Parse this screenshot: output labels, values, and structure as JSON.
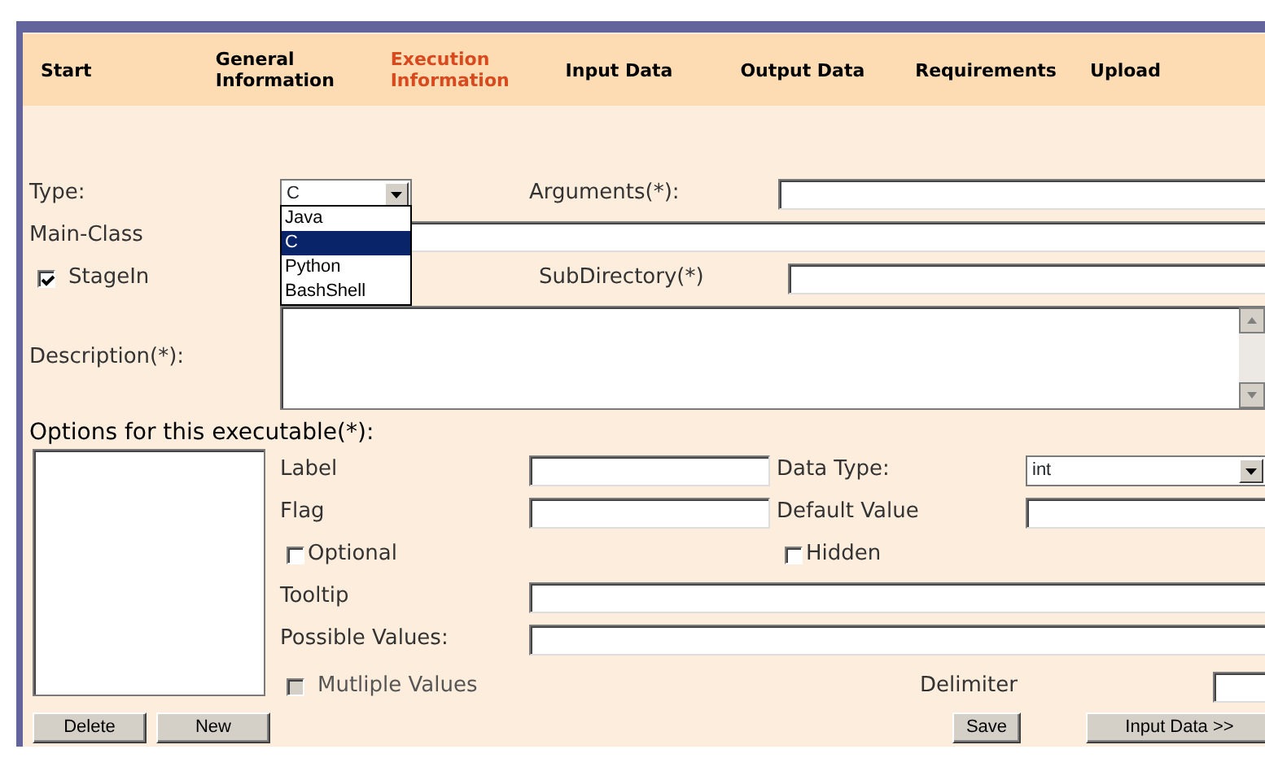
{
  "tabs": [
    {
      "label": "Start",
      "selected": false
    },
    {
      "label": "General Information",
      "selected": false
    },
    {
      "label": "Execution Information",
      "selected": true
    },
    {
      "label": "Input Data",
      "selected": false
    },
    {
      "label": "Output Data",
      "selected": false
    },
    {
      "label": "Requirements",
      "selected": false
    },
    {
      "label": "Upload",
      "selected": false
    }
  ],
  "type_field": {
    "label": "Type:",
    "value": "C",
    "expanded": true,
    "options": [
      {
        "label": "Java",
        "selected": false
      },
      {
        "label": "C",
        "selected": true
      },
      {
        "label": "Python",
        "selected": false
      },
      {
        "label": "BashShell",
        "selected": false
      }
    ]
  },
  "arguments": {
    "label": "Arguments(*):"
  },
  "main_class": {
    "label": "Main-Class"
  },
  "stage_in": {
    "label": "StageIn",
    "checked": true
  },
  "subdirectory": {
    "label": "SubDirectory(*)"
  },
  "description": {
    "label": "Description(*):"
  },
  "options_section": {
    "title": "Options for this executable(*):",
    "label_field": {
      "label": "Label"
    },
    "data_type": {
      "label": "Data Type:",
      "value": "int"
    },
    "flag_field": {
      "label": "Flag"
    },
    "default_value": {
      "label": "Default Value"
    },
    "optional": {
      "label": "Optional",
      "checked": false
    },
    "hidden": {
      "label": "Hidden",
      "checked": false
    },
    "tooltip": {
      "label": "Tooltip"
    },
    "possible_values": {
      "label": "Possible Values:"
    },
    "multiple_values": {
      "label": "Mutliple Values",
      "checked": false,
      "disabled": true
    },
    "delimiter": {
      "label": "Delimiter"
    }
  },
  "buttons": {
    "delete": "Delete",
    "new": "New",
    "save": "Save",
    "next": "Input Data >>"
  }
}
